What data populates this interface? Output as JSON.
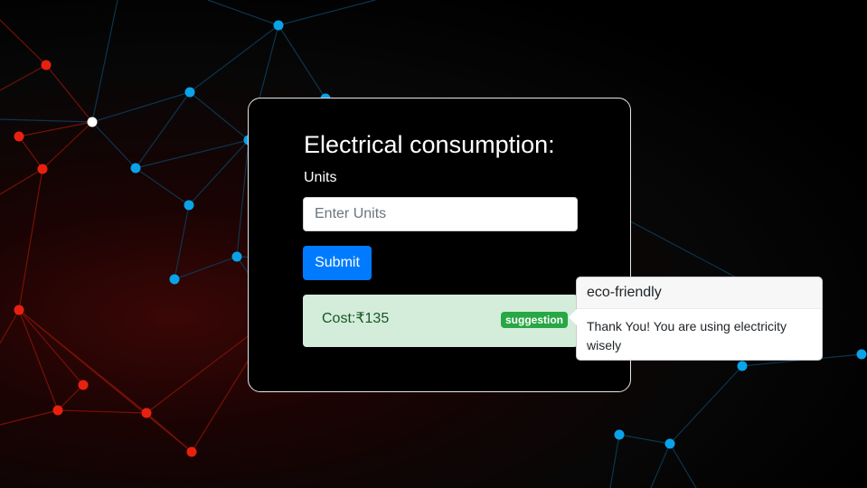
{
  "form": {
    "title": "Electrical consumption:",
    "units_label": "Units",
    "units_placeholder": "Enter Units",
    "units_value": "",
    "submit_label": "Submit"
  },
  "result": {
    "cost_text": "Cost:₹135",
    "badge_label": "suggestion"
  },
  "popover": {
    "header": "eco-friendly",
    "body": "Thank You! You are using electricity wisely"
  },
  "colors": {
    "primary": "#007bff",
    "success": "#28a745",
    "alert_bg": "#d4edda",
    "alert_text": "#155724",
    "node_blue": "#0aa2e8",
    "node_red": "#e8210f",
    "node_white": "#ffffff"
  }
}
